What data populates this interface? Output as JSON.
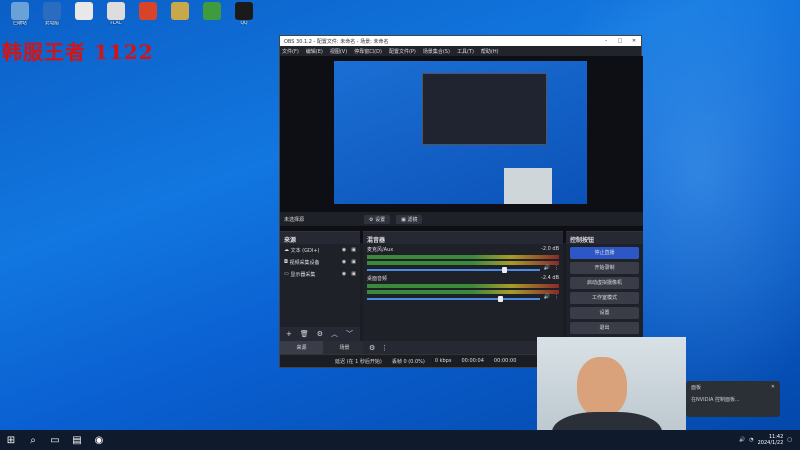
{
  "desktop": {
    "watermark": "韩服王者 1122",
    "icons": [
      {
        "label": "回收站",
        "color": "#6aa2d8"
      },
      {
        "label": "此电脑",
        "color": "#2b6cc1"
      },
      {
        "label": "",
        "color": "#e8e8e8"
      },
      {
        "label": "FLAC",
        "color": "#dddddd"
      },
      {
        "label": "",
        "color": "#d8442a"
      },
      {
        "label": "",
        "color": "#c8a84a"
      },
      {
        "label": "",
        "color": "#3e9c3e"
      },
      {
        "label": "QQ",
        "color": "#1a1a1a"
      }
    ]
  },
  "obs": {
    "title": "OBS 30.1.2 - 配置文件: 未命名 - 场景: 未命名",
    "menu": [
      "文件(F)",
      "编辑(E)",
      "视图(V)",
      "停靠窗口(D)",
      "配置文件(P)",
      "场景集合(S)",
      "工具(T)",
      "帮助(H)"
    ],
    "no_source": "未选择源",
    "props_btn": "⚙ 设置",
    "filters_btn": "▣ 滤镜",
    "sources": {
      "title": "来源",
      "items": [
        "文本 (GDI+)",
        "视频采集设备",
        "显示器采集"
      ]
    },
    "mixer": {
      "title": "混音器",
      "channels": [
        {
          "name": "麦克风/Aux",
          "db": "-2.0 dB",
          "level": 0.78
        },
        {
          "name": "桌面音频",
          "db": "-2.4 dB",
          "level": 0.76
        }
      ]
    },
    "controls": {
      "title": "控制按钮",
      "items": [
        "停止直播",
        "开始录制",
        "启动虚拟摄像机",
        "工作室模式",
        "设置",
        "退出"
      ]
    },
    "tabs": [
      "来源",
      "场景"
    ],
    "status": {
      "reconnect": "延迟 (在 1 秒后开始)",
      "dropped": "丢帧 0 (0.0%)",
      "kbps": "0 kbps",
      "time": "00:00:04",
      "rec": "00:00:00"
    }
  },
  "notification": {
    "title": "面板",
    "body": "在NVIDIA 控制面板..."
  },
  "taskbar": {
    "time": "11:42",
    "date": "2024/1/22"
  }
}
